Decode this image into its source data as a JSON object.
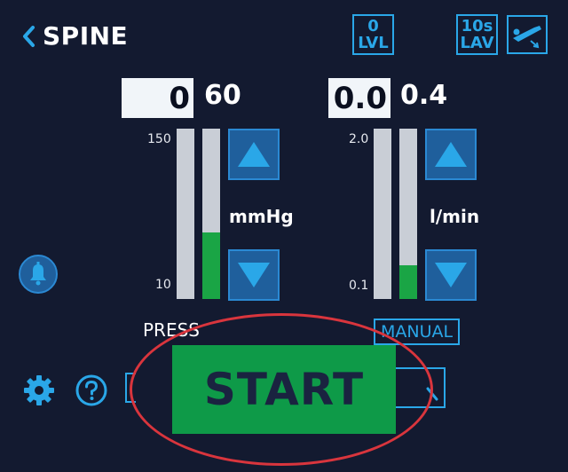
{
  "header": {
    "back_label": "SPINE",
    "level": {
      "value": "0",
      "label": "LVL"
    },
    "lavage": {
      "value": "10s",
      "label": "LAV"
    },
    "icons": {
      "back": "chevron-left-icon",
      "position": "patient-position-icon"
    }
  },
  "pressure": {
    "set_value": "0",
    "read_value": "60",
    "scale_max": "150",
    "scale_min": "10",
    "unit": "mmHg",
    "label": "PRESS",
    "bar_fill_fraction": 0.39
  },
  "flow": {
    "set_value": "0.0",
    "read_value": "0.4",
    "scale_max": "2.0",
    "scale_min": "0.1",
    "unit": "l/min",
    "mode": "MANUAL",
    "bar_fill_fraction": 0.2
  },
  "start_label": "START",
  "icons": {
    "bell": "bell-icon",
    "settings": "gear-icon",
    "help": "help-icon",
    "increase": "triangle-up-icon",
    "decrease": "triangle-down-icon"
  },
  "colors": {
    "background": "#131a30",
    "accent": "#2aa7e8",
    "start_button": "#0e9a48",
    "bar_fill": "#1aa545",
    "highlight_ring": "#d9353d"
  }
}
